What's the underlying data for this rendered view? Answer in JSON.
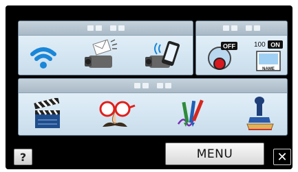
{
  "panels": {
    "wireless": {
      "items": [
        {
          "name": "wifi",
          "icon": "wifi-icon"
        },
        {
          "name": "send-to-device",
          "icon": "camera-send-icon"
        },
        {
          "name": "smartphone-link",
          "icon": "camera-smartphone-icon"
        }
      ]
    },
    "recording": {
      "items": [
        {
          "name": "recording-off",
          "icon": "record-off-icon",
          "badge": "OFF"
        },
        {
          "name": "name-card",
          "icon": "name-card-icon",
          "counter": "100",
          "status": "ON",
          "label": "NAME"
        }
      ]
    },
    "effects": {
      "items": [
        {
          "name": "clapperboard",
          "icon": "clapperboard-icon"
        },
        {
          "name": "face-glasses",
          "icon": "glasses-mustache-icon"
        },
        {
          "name": "pens",
          "icon": "pens-icon"
        },
        {
          "name": "stamp",
          "icon": "stamp-icon"
        }
      ]
    }
  },
  "buttons": {
    "help": "?",
    "menu": "MENU",
    "close": "✕"
  }
}
